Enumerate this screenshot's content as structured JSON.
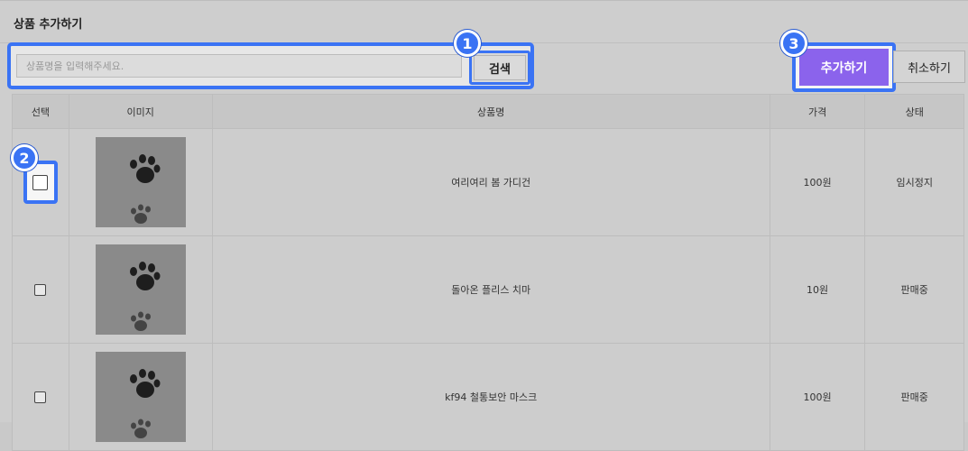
{
  "page": {
    "title": "상품 추가하기"
  },
  "toolbar": {
    "search_placeholder": "상품명을 입력해주세요.",
    "search_label": "검색",
    "add_label": "추가하기",
    "cancel_label": "취소하기"
  },
  "annotations": {
    "badge1": "1",
    "badge2": "2",
    "badge3": "3"
  },
  "table": {
    "headers": {
      "select": "선택",
      "image": "이미지",
      "name": "상품명",
      "price": "가격",
      "status": "상태"
    },
    "rows": [
      {
        "name": "여리여리 봄 가디건",
        "price": "100원",
        "status": "임시정지",
        "image": "paw-print-image"
      },
      {
        "name": "돌아온 플리스 치마",
        "price": "10원",
        "status": "판매중",
        "image": "paw-print-image"
      },
      {
        "name": "kf94 철통보안 마스크",
        "price": "100원",
        "status": "판매중",
        "image": "paw-print-image"
      }
    ]
  },
  "colors": {
    "highlight": "#3a73f4",
    "primary_button": "#8b63ec"
  }
}
